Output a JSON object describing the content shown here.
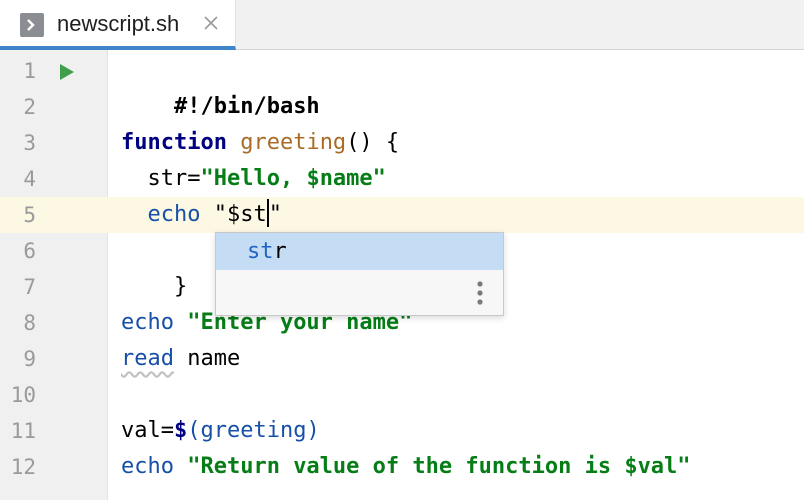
{
  "tab": {
    "title": "newscript.sh",
    "file_icon": "shell-file-icon",
    "close_icon": "close-icon"
  },
  "gutter": {
    "line_numbers": [
      "1",
      "2",
      "3",
      "4",
      "5",
      "6",
      "7",
      "8",
      "9",
      "10",
      "11",
      "12"
    ],
    "run_icon": "run-icon"
  },
  "code": {
    "line1": "#!/bin/bash",
    "line3_kw": "function",
    "line3_fn": "greeting",
    "line3_rest": "() {",
    "line4_var": "  str=",
    "line4_str": "\"Hello, $name\"",
    "line5_indent": "  ",
    "line5_cmd": "echo",
    "line5_str_pre": " \"$st",
    "line5_str_post": "\"",
    "line6": "}",
    "line8_cmd": "echo",
    "line8_str": " \"Enter your name\"",
    "line9_cmd": "read",
    "line9_rest": " name",
    "line11_var": "val=",
    "line11_dollar": "$",
    "line11_sub": "(greeting)",
    "line12_cmd": "echo",
    "line12_str": " \"Return value of the function is $val\""
  },
  "completion": {
    "item_match": "st",
    "item_rest": "r",
    "more_icon": "vertical-ellipsis-icon"
  },
  "colors": {
    "keyword": "#0033b3",
    "function_name": "#a86c27",
    "string": "#067d17",
    "current_line": "#fcf8e4",
    "tab_accent": "#4083c9",
    "completion_selected": "#c5dcf5"
  }
}
